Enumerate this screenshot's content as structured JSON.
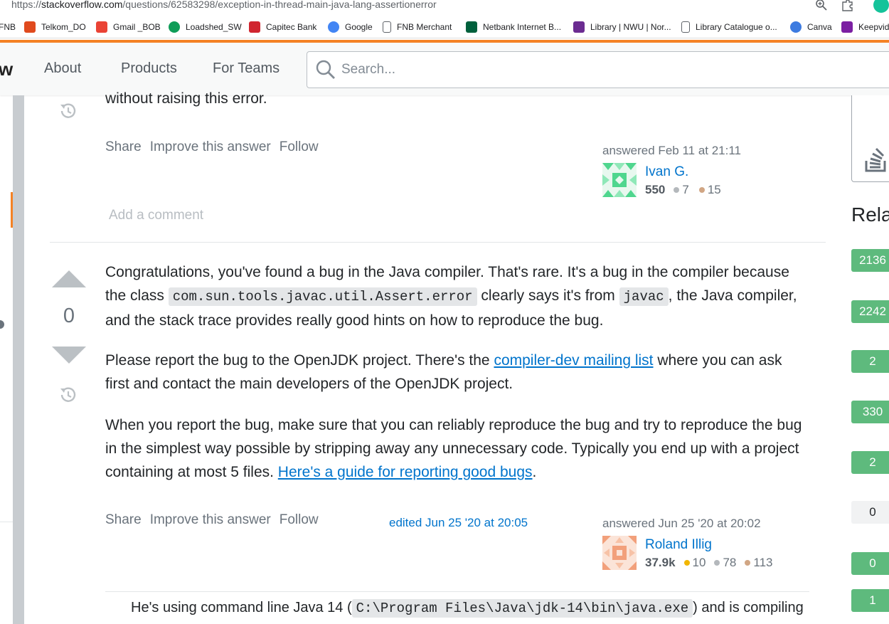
{
  "browser": {
    "url_prefix": "https://",
    "url_host": "stackoverflow.com",
    "url_path": "/questions/62583298/exception-in-thread-main-java-lang-assertionerror",
    "bookmarks": [
      {
        "label": "FNB",
        "icon": "fnb-icon",
        "color": "#00a3a3"
      },
      {
        "label": "Telkom_DO",
        "icon": "telkom-icon",
        "color": "#e04a1e"
      },
      {
        "label": "Gmail _BOB",
        "icon": "gmail-icon",
        "color": "#ea4335"
      },
      {
        "label": "Loadshed_SW",
        "icon": "pin-icon",
        "color": "#0f9d58"
      },
      {
        "label": "Capitec Bank",
        "icon": "capitec-icon",
        "color": "#d0252f"
      },
      {
        "label": "Google",
        "icon": "google-icon",
        "color": "#4285f4"
      },
      {
        "label": "FNB Merchant",
        "icon": "page-icon",
        "color": "#5f6368"
      },
      {
        "label": "Netbank Internet B...",
        "icon": "nedbank-icon",
        "color": "#00603c"
      },
      {
        "label": "Library | NWU | Nor...",
        "icon": "library-icon",
        "color": "#6b2c91"
      },
      {
        "label": "Library Catalogue o...",
        "icon": "page-icon",
        "color": "#5f6368"
      },
      {
        "label": "Canva",
        "icon": "canva-icon",
        "color": "#3d7be0"
      },
      {
        "label": "Keepvid",
        "icon": "keepvid-icon",
        "color": "#7b1fa2"
      }
    ]
  },
  "header": {
    "logo_fragment": "w",
    "nav": [
      "About",
      "Products",
      "For Teams"
    ],
    "search_placeholder": "Search..."
  },
  "answer1": {
    "text_tail": "without raising this error.",
    "menu": [
      "Share",
      "Improve this answer",
      "Follow"
    ],
    "answered": "answered Feb 11 at 21:11",
    "user": {
      "name": "Ivan G.",
      "rep": "550",
      "silver": "7",
      "bronze": "15"
    },
    "add_comment": "Add a comment"
  },
  "answer2": {
    "votes": "0",
    "p1": {
      "a": "Congratulations, you've found a bug in the Java compiler. That's rare. It's a bug in the compiler because the class ",
      "code1": "com.sun.tools.javac.util.Assert.error",
      "b": " clearly says it's from ",
      "code2": "javac",
      "c": ", the Java compiler, and the stack trace provides really good hints on how to reproduce the bug."
    },
    "p2": {
      "a": "Please report the bug to the OpenJDK project. There's the ",
      "link": "compiler-dev mailing list",
      "b": " where you can ask first and contact the main developers of the OpenJDK project."
    },
    "p3": {
      "a": "When you report the bug, make sure that you can reliably reproduce the bug and try to reproduce the bug in the simplest way possible by stripping away any unnecessary code. Typically you end up with a project containing at most 5 files. ",
      "link": "Here's a guide for reporting good bugs",
      "b": "."
    },
    "menu": [
      "Share",
      "Improve this answer",
      "Follow"
    ],
    "edited": "edited Jun 25 '20 at 20:05",
    "answered": "answered Jun 25 '20 at 20:02",
    "user": {
      "name": "Roland Illig",
      "rep": "37.9k",
      "gold": "10",
      "silver": "78",
      "bronze": "113"
    },
    "comment": {
      "a": "He's using command line Java 14 (",
      "code": "C:\\Program Files\\Java\\jdk-14\\bin\\java.exe",
      "b": ") and is compiling"
    }
  },
  "sidebar": {
    "related_title": "Rela",
    "related_counts": [
      {
        "value": "2136",
        "answered": true
      },
      {
        "value": "2242",
        "answered": true
      },
      {
        "value": "2",
        "answered": true
      },
      {
        "value": "330",
        "answered": true
      },
      {
        "value": "2",
        "answered": true
      },
      {
        "value": "0",
        "answered": false
      },
      {
        "value": "0",
        "answered": true
      },
      {
        "value": "1",
        "answered": true
      }
    ]
  },
  "colors": {
    "accent_orange": "#f48225",
    "link_blue": "#0074cc",
    "answered_green": "#5eba7d",
    "gold": "#f1b600",
    "silver": "#b4b8bc",
    "bronze": "#d1a684"
  }
}
